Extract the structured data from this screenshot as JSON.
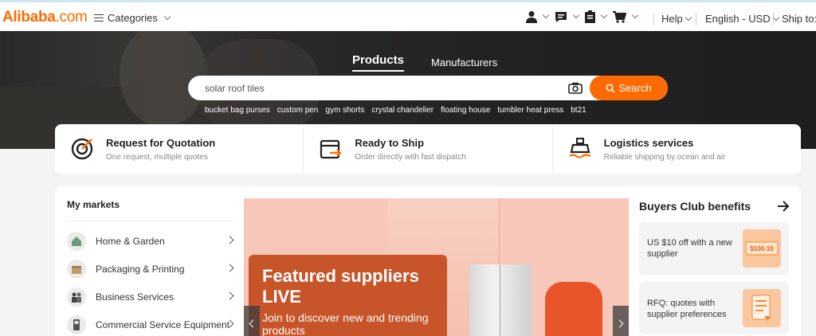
{
  "header": {
    "logo_text": "Alibaba",
    "logo_domain": ".com",
    "categories_label": "Categories",
    "help_label": "Help",
    "language_label": "English - USD",
    "ship_to_label": "Ship to:"
  },
  "hero": {
    "tabs": [
      {
        "label": "Products",
        "active": true
      },
      {
        "label": "Manufacturers",
        "active": false
      }
    ],
    "search": {
      "value": "solar roof tiles",
      "button_label": "Search"
    },
    "suggestions": [
      "bucket bag purses",
      "custom pen",
      "gym shorts",
      "crystal chandelier",
      "floating house",
      "tumbler heat press",
      "bt21"
    ]
  },
  "services": [
    {
      "title": "Request for Quotation",
      "subtitle": "One request, multiple quotes",
      "icon": "target-icon"
    },
    {
      "title": "Ready to Ship",
      "subtitle": "Order directly with fast dispatch",
      "icon": "shipping-box-icon"
    },
    {
      "title": "Logistics services",
      "subtitle": "Reliable shipping by ocean and air",
      "icon": "ship-icon"
    }
  ],
  "markets": {
    "title": "My markets",
    "items": [
      {
        "label": "Home & Garden"
      },
      {
        "label": "Packaging & Printing"
      },
      {
        "label": "Business Services"
      },
      {
        "label": "Commercial Service Equipment"
      }
    ]
  },
  "banner": {
    "heading": "Featured suppliers LIVE",
    "text": "Join to discover new and trending products"
  },
  "buyers_club": {
    "title": "Buyers Club benefits",
    "cards": [
      {
        "text": "US $10 off with a new supplier",
        "badge": "$100-10"
      },
      {
        "text": "RFQ: quotes with supplier preferences"
      }
    ]
  },
  "colors": {
    "accent": "#ff6a00",
    "banner_bg": "#f7c8b9",
    "featured_bg": "#c8552a"
  }
}
